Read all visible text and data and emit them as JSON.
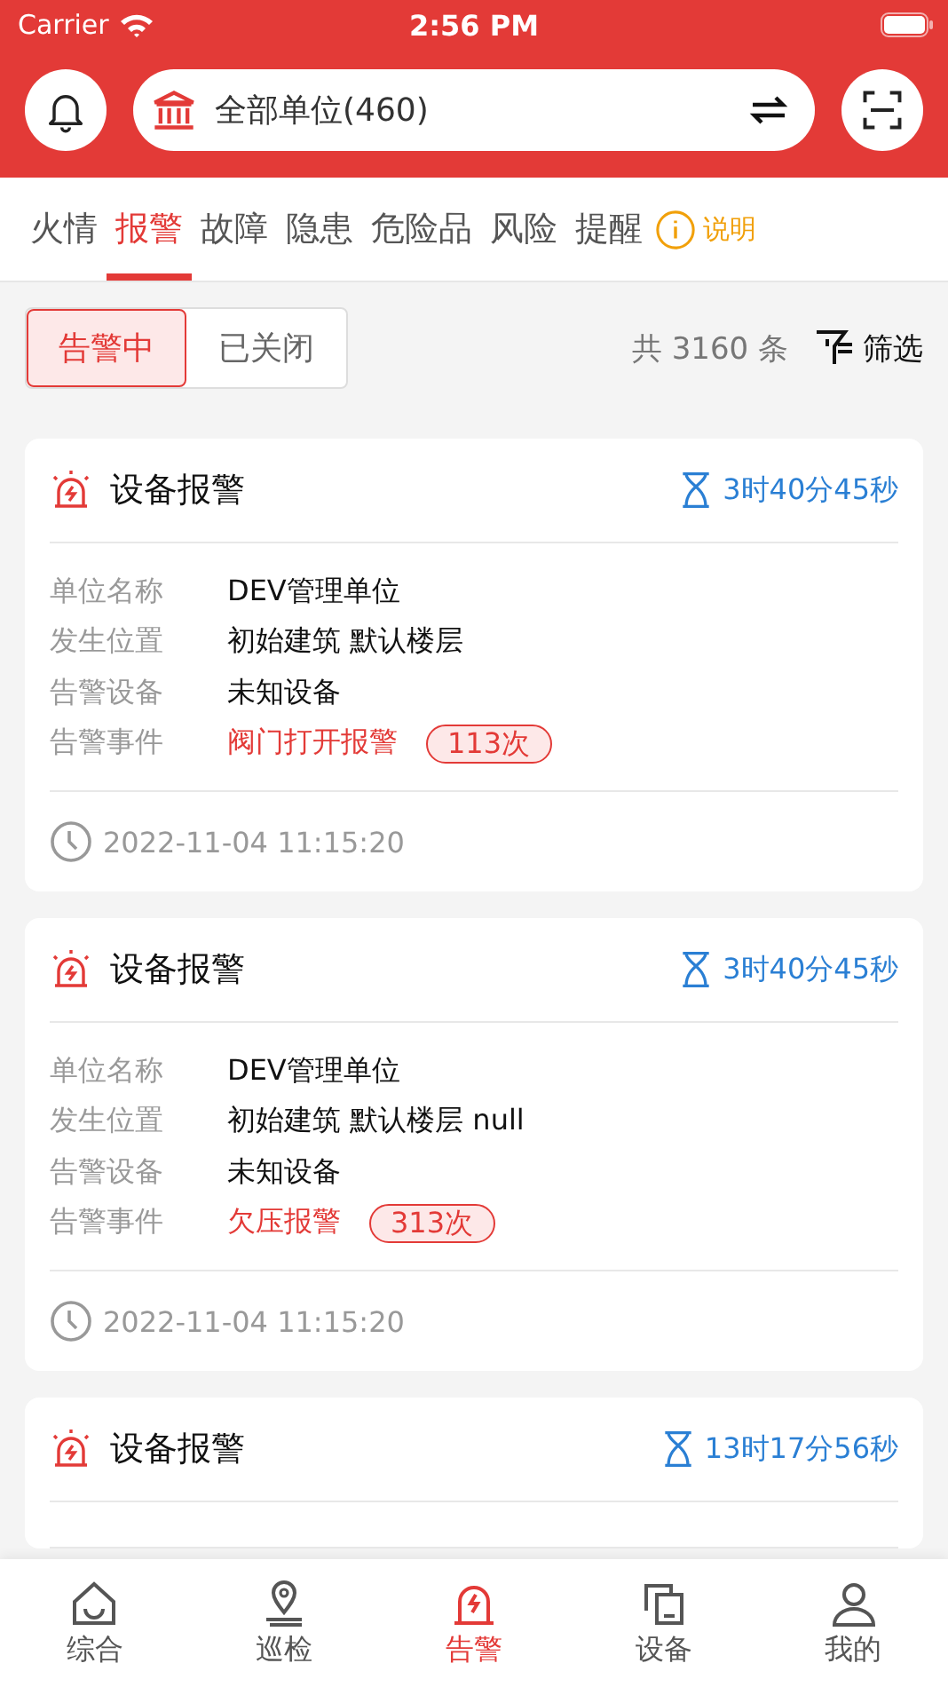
{
  "status_bar": {
    "carrier": "Carrier",
    "time": "2:56 PM"
  },
  "header": {
    "unit_selector": "全部单位(460)"
  },
  "tabs": [
    {
      "label": "火情",
      "selected": false
    },
    {
      "label": "报警",
      "selected": true
    },
    {
      "label": "故障",
      "selected": false
    },
    {
      "label": "隐患",
      "selected": false
    },
    {
      "label": "危险品",
      "selected": false
    },
    {
      "label": "风险",
      "selected": false
    },
    {
      "label": "提醒",
      "selected": false
    }
  ],
  "help_link": "说明",
  "segments": [
    {
      "label": "告警中",
      "selected": true
    },
    {
      "label": "已关闭",
      "selected": false
    }
  ],
  "total": "共 3160 条",
  "filter": "筛选",
  "cards": [
    {
      "title": "设备报警",
      "duration": "3时40分45秒",
      "fields": [
        {
          "label": "单位名称",
          "value": "DEV管理单位",
          "kind": "plain"
        },
        {
          "label": "发生位置",
          "value": "初始建筑 默认楼层",
          "kind": "plain"
        },
        {
          "label": "告警设备",
          "value": "未知设备",
          "kind": "plain"
        },
        {
          "label": "告警事件",
          "value": "阀门打开报警",
          "kind": "event",
          "count": "113次"
        }
      ],
      "time": "2022-11-04 11:15:20"
    },
    {
      "title": "设备报警",
      "duration": "3时40分45秒",
      "fields": [
        {
          "label": "单位名称",
          "value": "DEV管理单位",
          "kind": "plain"
        },
        {
          "label": "发生位置",
          "value": "初始建筑 默认楼层 null",
          "kind": "plain"
        },
        {
          "label": "告警设备",
          "value": "未知设备",
          "kind": "plain"
        },
        {
          "label": "告警事件",
          "value": "欠压报警",
          "kind": "event",
          "count": "313次"
        }
      ],
      "time": "2022-11-04 11:15:20"
    },
    {
      "title": "设备报警",
      "duration": "13时17分56秒"
    }
  ],
  "bottom_nav": [
    {
      "label": "综合",
      "kind": "home",
      "selected": false
    },
    {
      "label": "巡检",
      "kind": "pin",
      "selected": false
    },
    {
      "label": "告警",
      "kind": "alarm",
      "selected": true
    },
    {
      "label": "设备",
      "kind": "device",
      "selected": false
    },
    {
      "label": "我的",
      "kind": "user",
      "selected": false
    }
  ]
}
